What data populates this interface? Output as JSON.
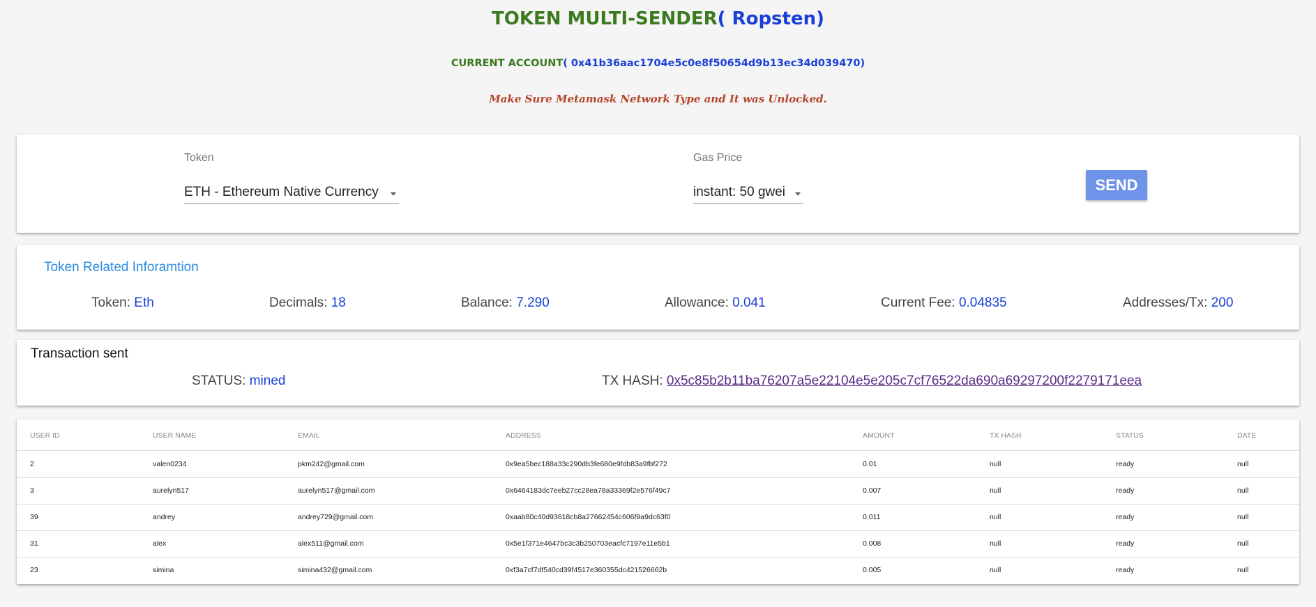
{
  "header": {
    "title_main": "TOKEN MULTI-SENDER",
    "title_network": "( Ropsten)",
    "account_label": "CURRENT ACCOUNT",
    "account_value": "( 0x41b36aac1704e5c0e8f50654d9b13ec34d039470)",
    "warning": "Make Sure Metamask Network Type and It was Unlocked."
  },
  "controls": {
    "token_label": "Token",
    "token_value": "ETH - Ethereum Native Currency",
    "gas_label": "Gas Price",
    "gas_value": "instant: 50 gwei",
    "send_label": "SEND"
  },
  "info": {
    "title": "Token Related Inforamtion",
    "token_label": "Token: ",
    "token_value": "Eth",
    "decimals_label": "Decimals: ",
    "decimals_value": "18",
    "balance_label": "Balance: ",
    "balance_value": "7.290",
    "allowance_label": "Allowance: ",
    "allowance_value": "0.041",
    "fee_label": "Current Fee: ",
    "fee_value": "0.04835",
    "addr_label": "Addresses/Tx: ",
    "addr_value": "200"
  },
  "tx": {
    "title": "Transaction sent",
    "status_label": "STATUS: ",
    "status_value": "mined",
    "hash_label": "TX HASH: ",
    "hash_value": "0x5c85b2b11ba76207a5e22104e5e205c7cf76522da690a69297200f2279171eea"
  },
  "table": {
    "columns": [
      "USER ID",
      "USER NAME",
      "EMAIL",
      "ADDRESS",
      "AMOUNT",
      "TX HASH",
      "STATUS",
      "DATE"
    ],
    "rows": [
      [
        "2",
        "valen0234",
        "pkm242@gmail.com",
        "0x9ea5bec188a33c290db3fe680e9fdb83a9fbf272",
        "0.01",
        "null",
        "ready",
        "null"
      ],
      [
        "3",
        "aurelyn517",
        "aurelyn517@gmail.com",
        "0x6464183dc7eeb27cc28ea78a33369f2e576f49c7",
        "0.007",
        "null",
        "ready",
        "null"
      ],
      [
        "39",
        "andrey",
        "andrey729@gmail.com",
        "0xaab80c40d93618cb8a27662454c606f9a9dc63f0",
        "0.011",
        "null",
        "ready",
        "null"
      ],
      [
        "31",
        "alex",
        "alex511@gmail.com",
        "0x5e1f371e4647bc3c3b250703eacfc7197e11e5b1",
        "0.008",
        "null",
        "ready",
        "null"
      ],
      [
        "23",
        "simina",
        "simina432@gmail.com",
        "0xf3a7cf7df540cd39f4517e360355dc421526662b",
        "0.005",
        "null",
        "ready",
        "null"
      ]
    ]
  }
}
